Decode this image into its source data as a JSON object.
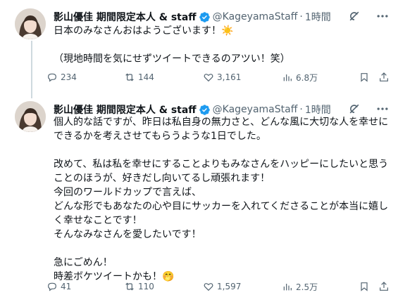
{
  "tweets": [
    {
      "display_name": "影山優佳 期間限定本人 & staff",
      "handle": "@KageyamaStaff",
      "separator": "·",
      "time": "1時間",
      "lines": [
        "日本のみなさんおはようございます！☀️",
        "",
        "（現地時間を気にせずツイートできるのアツい！笑）"
      ],
      "stats": {
        "replies": "234",
        "retweets": "144",
        "likes": "3,161",
        "views": "6.8万"
      }
    },
    {
      "display_name": "影山優佳 期間限定本人 & staff",
      "handle": "@KageyamaStaff",
      "separator": "·",
      "time": "1時間",
      "lines": [
        "個人的な話ですが、昨日は私自身の無力さと、どんな風に大切な人を幸せに",
        "できるかを考えさせてもらうような1日でした。",
        "",
        "改めて、私は私を幸せにすることよりもみなさんをハッピーにしたいと思う",
        "ことのほうが、好きだし向いてるし頑張れます！",
        "今回のワールドカップで言えば、",
        "どんな形でもあなたの心や目にサッカーを入れてくださることが本当に嬉し",
        "く幸せなことです！",
        "そんなみなさんを愛したいです！",
        "",
        "急にごめん！",
        "時差ボケツイートかも！🤭"
      ],
      "stats": {
        "replies": "41",
        "retweets": "110",
        "likes": "1,597",
        "views": "2.5万"
      }
    }
  ],
  "icons": {
    "verified": "verified-badge-icon",
    "grok": "grok-icon",
    "more": "more-icon",
    "reply": "reply-icon",
    "retweet": "retweet-icon",
    "like": "like-icon",
    "views": "views-icon",
    "bookmark": "bookmark-icon",
    "share": "share-icon"
  },
  "colors": {
    "text": "#0f1419",
    "secondary": "#536471",
    "verified": "#1d9bf0",
    "thread_line": "#cfd9de"
  }
}
